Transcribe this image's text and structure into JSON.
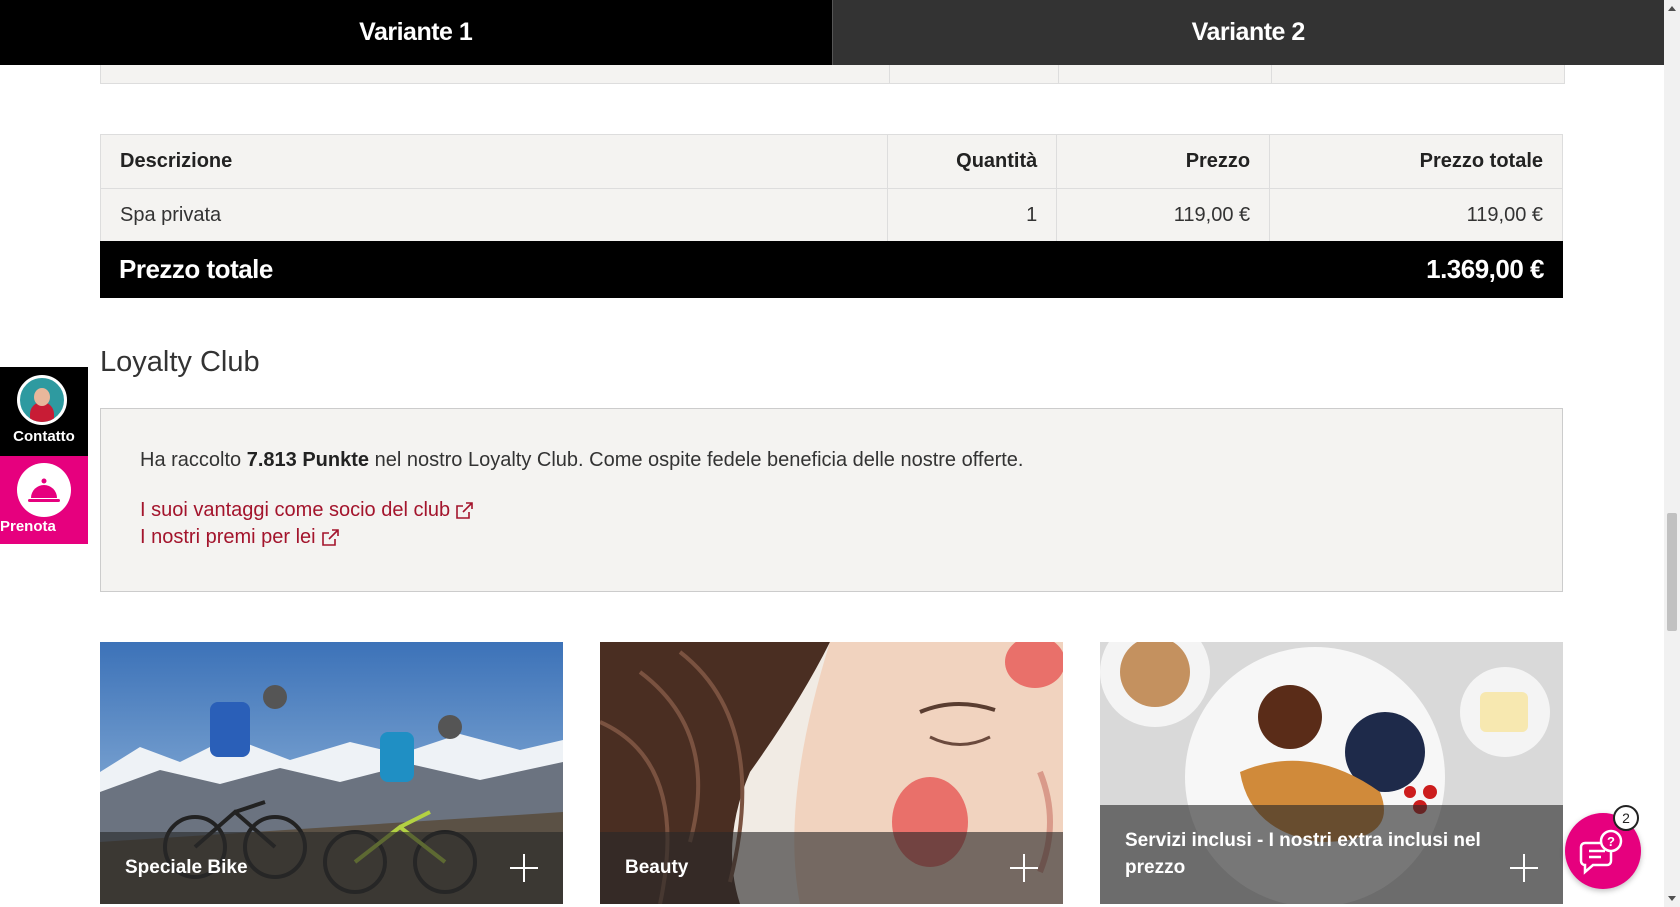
{
  "tabs": [
    {
      "label": "Variante 1",
      "active": true
    },
    {
      "label": "Variante 2",
      "active": false
    }
  ],
  "price_table": {
    "headers": {
      "description": "Descrizione",
      "quantity": "Quantità",
      "price": "Prezzo",
      "total": "Prezzo totale"
    },
    "rows": [
      {
        "description": "Spa privata",
        "quantity": "1",
        "price": "119,00 €",
        "total": "119,00 €"
      }
    ]
  },
  "grand_total": {
    "label": "Prezzo totale",
    "value": "1.369,00 €"
  },
  "loyalty": {
    "title": "Loyalty Club",
    "text_before": "Ha raccolto ",
    "points": "7.813 Punkte",
    "text_after": " nel nostro Loyalty Club. Come ospite fedele beneficia delle nostre offerte.",
    "links": [
      {
        "label": "I suoi vantaggi come socio del club",
        "icon": "external-link-icon"
      },
      {
        "label": "I nostri premi per lei",
        "icon": "external-link-icon"
      }
    ]
  },
  "side_widgets": {
    "contact_label": "Contatto",
    "book_label": "Prenota"
  },
  "cards": [
    {
      "title": "Speciale Bike",
      "icon": "plus-icon"
    },
    {
      "title": "Beauty",
      "icon": "plus-icon"
    },
    {
      "title": "Servizi inclusi - I nostri extra inclusi nel prezzo",
      "icon": "plus-icon"
    }
  ],
  "help": {
    "badge": "2",
    "icon": "chat-question-icon"
  },
  "colors": {
    "accent_pink": "#e6007e",
    "link_red": "#a3142c",
    "black": "#000000",
    "panel_bg": "#f4f3f1"
  }
}
